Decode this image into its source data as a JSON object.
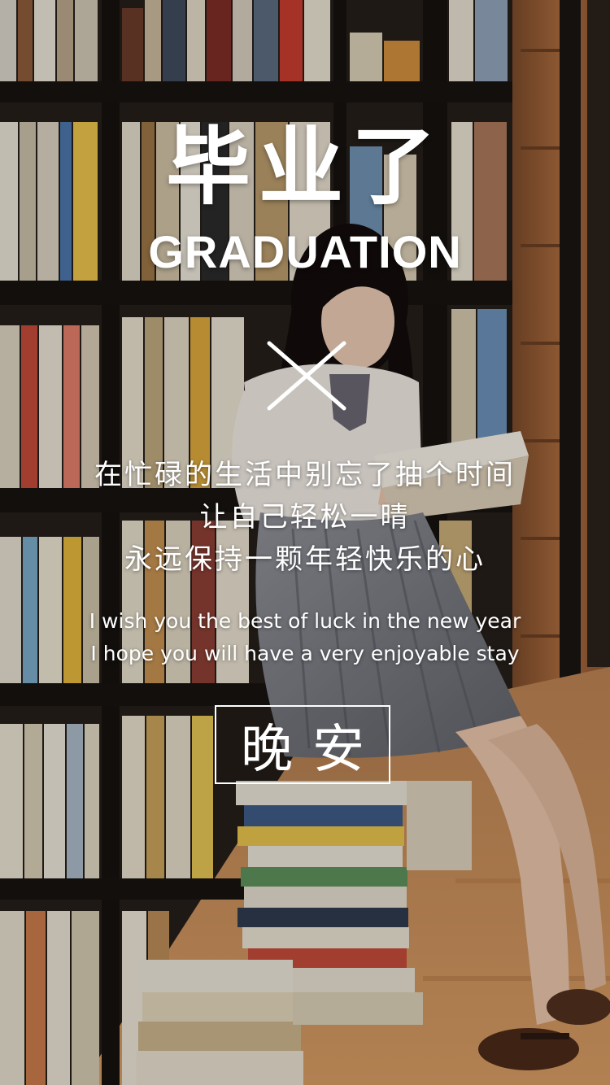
{
  "title": {
    "chinese": "毕业了",
    "english": "GRADUATION"
  },
  "divider": {
    "icon": "cross-icon"
  },
  "message": {
    "chinese_lines": [
      "在忙碌的生活中别忘了抽个时间",
      "让自己轻松一晴",
      "永远保持一颗年轻快乐的心"
    ],
    "english_lines": [
      "I wish you the best of luck in the new year",
      "I hope you will have a very enjoyable stay"
    ]
  },
  "button": {
    "label": "晚安"
  },
  "colors": {
    "text": "#ffffff",
    "shelf_dark": "#1f1a17",
    "wood": "#a3643a",
    "floor": "#c98c55"
  }
}
